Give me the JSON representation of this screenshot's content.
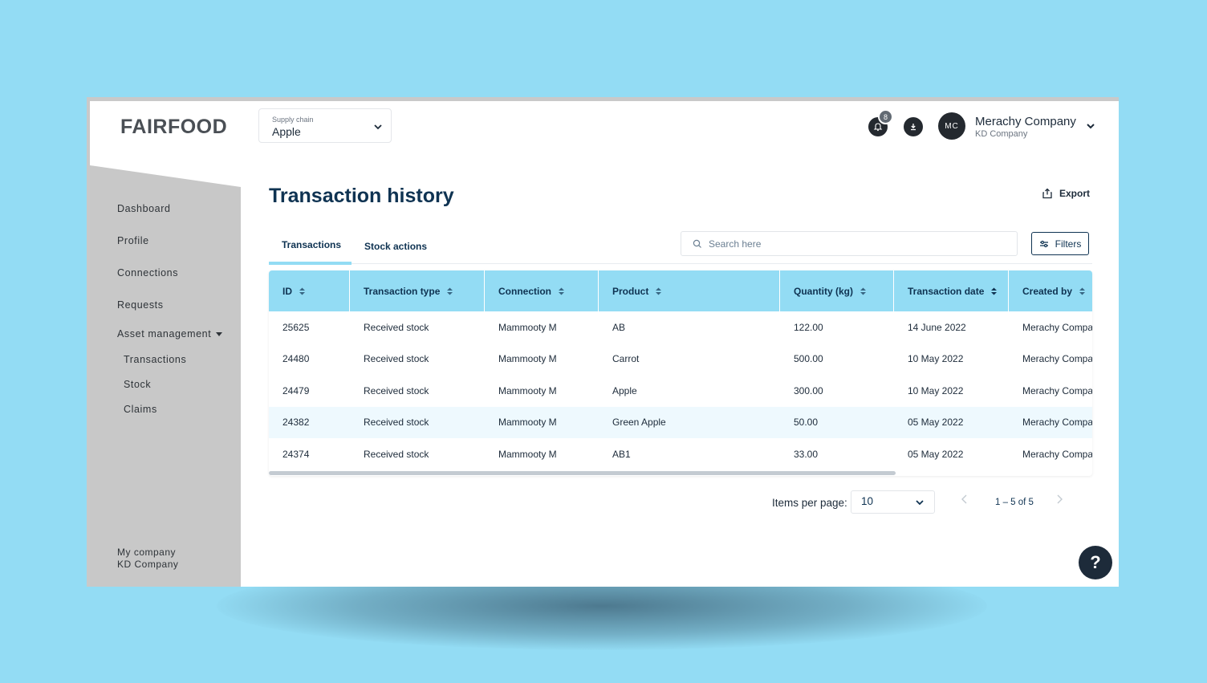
{
  "brand": {
    "logo": "FAIRFOOD"
  },
  "header": {
    "supply_chain_label": "Supply chain",
    "supply_chain_value": "Apple",
    "notification_count": "8",
    "avatar_initials": "MC",
    "user_name": "Merachy Company",
    "user_company": "KD Company"
  },
  "sidebar": {
    "items": [
      {
        "label": "Dashboard"
      },
      {
        "label": "Profile"
      },
      {
        "label": "Connections"
      },
      {
        "label": "Requests"
      },
      {
        "label": "Asset management"
      }
    ],
    "subitems": [
      {
        "label": "Transactions"
      },
      {
        "label": "Stock"
      },
      {
        "label": "Claims"
      }
    ],
    "footer_label": "My company",
    "footer_company": "KD Company"
  },
  "main": {
    "title": "Transaction history",
    "export_label": "Export",
    "tabs": [
      {
        "label": "Transactions",
        "active": true
      },
      {
        "label": "Stock actions",
        "active": false
      }
    ],
    "search_placeholder": "Search here",
    "filters_label": "Filters"
  },
  "table": {
    "columns": [
      "ID",
      "Transaction type",
      "Connection",
      "Product",
      "Quantity (kg)",
      "Transaction date",
      "Created by"
    ],
    "rows": [
      [
        "25625",
        "Received stock",
        "Mammooty M",
        "AB",
        "122.00",
        "14 June 2022",
        "Merachy Compa"
      ],
      [
        "24480",
        "Received stock",
        "Mammooty M",
        "Carrot",
        "500.00",
        "10 May 2022",
        "Merachy Compa"
      ],
      [
        "24479",
        "Received stock",
        "Mammooty M",
        "Apple",
        "300.00",
        "10 May 2022",
        "Merachy Compa"
      ],
      [
        "24382",
        "Received stock",
        "Mammooty M",
        "Green Apple",
        "50.00",
        "05 May 2022",
        "Merachy Compa"
      ],
      [
        "24374",
        "Received stock",
        "Mammooty M",
        "AB1",
        "33.00",
        "05 May 2022",
        "Merachy Compa"
      ]
    ]
  },
  "pagination": {
    "items_per_page_label": "Items per page:",
    "items_per_page_value": "10",
    "range": "1 – 5 of 5"
  },
  "help": {
    "label": "?"
  },
  "colors": {
    "accent": "#93dcf4",
    "navy": "#0f3352",
    "sidebar": "#c8c8c8"
  }
}
